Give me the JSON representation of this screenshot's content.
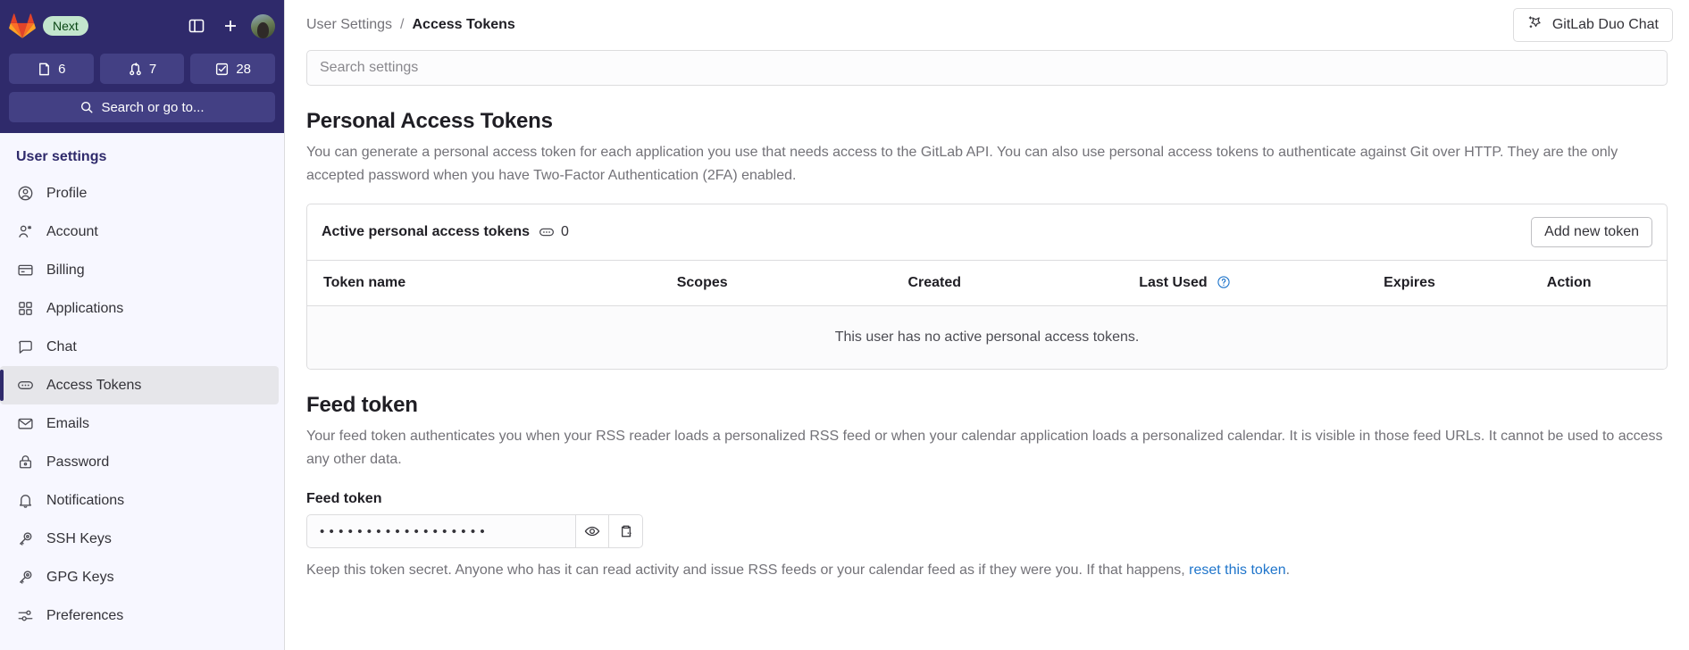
{
  "sidebar": {
    "brand": {
      "logo_icon": "gitlab-logo-icon",
      "next_badge": "Next"
    },
    "actions": [
      {
        "name": "toggle-sidebar-button",
        "icon": "panel-toggle-icon"
      },
      {
        "name": "create-new-button",
        "icon": "plus-icon"
      }
    ],
    "avatar_name": "user-avatar",
    "counters": [
      {
        "icon": "issues-icon",
        "value": "6",
        "name": "issues-counter"
      },
      {
        "icon": "merge-request-icon",
        "value": "7",
        "name": "merge-requests-counter"
      },
      {
        "icon": "todos-icon",
        "value": "28",
        "name": "todos-counter"
      }
    ],
    "search": {
      "label": "Search or go to...",
      "icon": "search-icon"
    },
    "section_title": "User settings",
    "items": [
      {
        "label": "Profile",
        "icon": "profile-icon",
        "active": false
      },
      {
        "label": "Account",
        "icon": "account-icon",
        "active": false
      },
      {
        "label": "Billing",
        "icon": "billing-card-icon",
        "active": false
      },
      {
        "label": "Applications",
        "icon": "applications-grid-icon",
        "active": false
      },
      {
        "label": "Chat",
        "icon": "chat-bubble-icon",
        "active": false
      },
      {
        "label": "Access Tokens",
        "icon": "token-icon",
        "active": true
      },
      {
        "label": "Emails",
        "icon": "envelope-icon",
        "active": false
      },
      {
        "label": "Password",
        "icon": "lock-icon",
        "active": false
      },
      {
        "label": "Notifications",
        "icon": "bell-icon",
        "active": false
      },
      {
        "label": "SSH Keys",
        "icon": "key-icon",
        "active": false
      },
      {
        "label": "GPG Keys",
        "icon": "key-icon",
        "active": false
      },
      {
        "label": "Preferences",
        "icon": "preferences-sliders-icon",
        "active": false
      }
    ]
  },
  "topbar": {
    "breadcrumb": {
      "parent": "User Settings",
      "separator": "/",
      "current": "Access Tokens"
    },
    "duo_chat": {
      "label": "GitLab Duo Chat",
      "icon": "gitlab-duo-icon"
    }
  },
  "search_settings": {
    "placeholder": "Search settings",
    "value": ""
  },
  "personal_access_tokens": {
    "heading": "Personal Access Tokens",
    "description": "You can generate a personal access token for each application you use that needs access to the GitLab API. You can also use personal access tokens to authenticate against Git over HTTP. They are the only accepted password when you have Two-Factor Authentication (2FA) enabled.",
    "card": {
      "title": "Active personal access tokens",
      "count_icon": "token-icon",
      "count": "0",
      "add_button": "Add new token"
    },
    "table": {
      "columns": [
        "Token name",
        "Scopes",
        "Created",
        "Last Used",
        "Expires",
        "Action"
      ],
      "last_used_help_icon": "question-circle-icon",
      "empty_message": "This user has no active personal access tokens."
    }
  },
  "feed_token": {
    "heading": "Feed token",
    "description": "Your feed token authenticates you when your RSS reader loads a personalized RSS feed or when your calendar application loads a personalized calendar. It is visible in those feed URLs. It cannot be used to access any other data.",
    "field_label": "Feed token",
    "masked_value": "••••••••••••••••••",
    "reveal_icon": "eye-icon",
    "copy_icon": "clipboard-icon",
    "footer_text": "Keep this token secret. Anyone who has it can read activity and issue RSS feeds or your calendar feed as if they were you. If that happens, ",
    "footer_link": "reset this token",
    "footer_suffix": "."
  },
  "colors": {
    "sidebar_dark": "#2f2a6b",
    "sidebar_bg": "#f7f7ff",
    "accent_link": "#1f75cb",
    "next_badge_bg": "#c3e6cd"
  }
}
